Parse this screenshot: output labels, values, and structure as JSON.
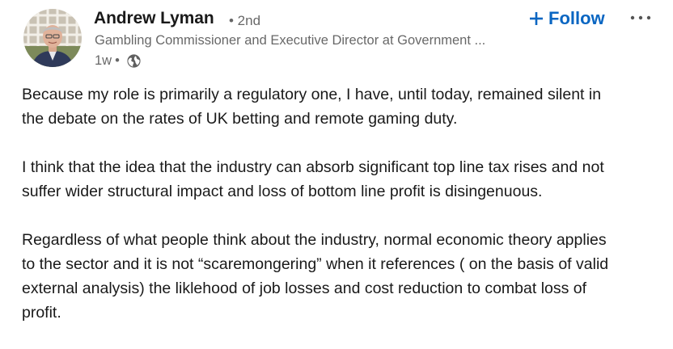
{
  "post": {
    "author": {
      "name": "Andrew Lyman",
      "degree": "• 2nd",
      "headline": "Gambling Commissioner and Executive Director at Government ...",
      "posted": "1w",
      "visibility_separator": "•",
      "visibility_icon": "globe-icon"
    },
    "actions": {
      "follow_label": "Follow",
      "follow_icon": "plus-icon",
      "more_icon": "ellipsis-icon"
    },
    "body": {
      "paragraphs": [
        "Because my role is primarily a regulatory one, I have, until today, remained silent in\nthe debate on the rates of UK betting and remote gaming duty.",
        "I think that the idea that the industry can absorb significant top line tax rises and not\nsuffer wider structural impact and loss of bottom line profit is disingenuous.",
        "Regardless of what people think about the industry, normal economic theory applies\nto the sector and it is not “scaremongering” when it references ( on the basis of valid\nexternal analysis) the liklehood of job losses and cost reduction to combat loss of\nprofit."
      ]
    },
    "colors": {
      "accent": "#0a66c2",
      "text_primary": "#191919",
      "text_secondary": "#666666"
    }
  }
}
